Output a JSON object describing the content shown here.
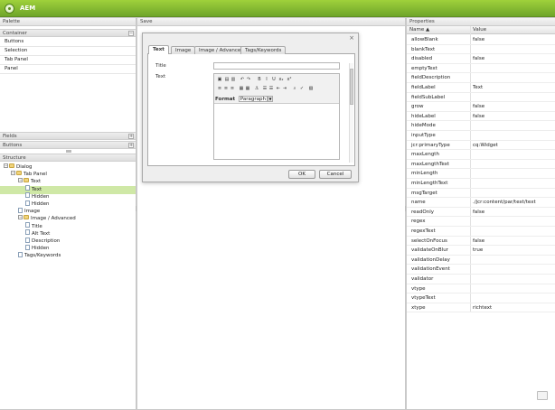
{
  "app": {
    "title": "AEM"
  },
  "palette": {
    "title": "Palette",
    "container_section": "Container",
    "container_items": [
      "Buttons",
      "Selection",
      "Tab Panel",
      "Panel"
    ],
    "fields_section": "Fields",
    "buttons_section": "Buttons",
    "collapse_symbol": "−",
    "expand_symbol": "+"
  },
  "structure": {
    "title": "Structure",
    "nodes": [
      {
        "label": "Dialog",
        "type": "folder",
        "depth": 0,
        "expandable": true,
        "selected": false
      },
      {
        "label": "Tab Panel",
        "type": "folder",
        "depth": 1,
        "expandable": true,
        "selected": false
      },
      {
        "label": "Text",
        "type": "folder",
        "depth": 2,
        "expandable": true,
        "selected": false
      },
      {
        "label": "Text",
        "type": "page",
        "depth": 3,
        "expandable": false,
        "selected": true
      },
      {
        "label": "Hidden",
        "type": "page",
        "depth": 3,
        "expandable": false,
        "selected": false
      },
      {
        "label": "Hidden",
        "type": "page",
        "depth": 3,
        "expandable": false,
        "selected": false
      },
      {
        "label": "Image",
        "type": "page",
        "depth": 2,
        "expandable": false,
        "selected": false
      },
      {
        "label": "Image / Advanced",
        "type": "folder",
        "depth": 2,
        "expandable": true,
        "selected": false
      },
      {
        "label": "Title",
        "type": "page",
        "depth": 3,
        "expandable": false,
        "selected": false
      },
      {
        "label": "Alt Text",
        "type": "page",
        "depth": 3,
        "expandable": false,
        "selected": false
      },
      {
        "label": "Description",
        "type": "page",
        "depth": 3,
        "expandable": false,
        "selected": false
      },
      {
        "label": "Hidden",
        "type": "page",
        "depth": 3,
        "expandable": false,
        "selected": false
      },
      {
        "label": "Tags/Keywords",
        "type": "page",
        "depth": 2,
        "expandable": false,
        "selected": false
      }
    ]
  },
  "save": {
    "title": "Save"
  },
  "dialog": {
    "close_symbol": "×",
    "tabs": [
      "Text",
      "Image",
      "Image / Advanced",
      "Tags/Keywords"
    ],
    "active_tab": 0,
    "title_label": "Title",
    "title_value": "",
    "text_label": "Text",
    "format_label": "Format",
    "format_value": "Paragraph",
    "ok_label": "OK",
    "cancel_label": "Cancel"
  },
  "properties": {
    "title": "Properties",
    "col_name": "Name ▲",
    "col_value": "Value",
    "rows": [
      {
        "name": "allowBlank",
        "value": "false"
      },
      {
        "name": "blankText",
        "value": ""
      },
      {
        "name": "disabled",
        "value": "false"
      },
      {
        "name": "emptyText",
        "value": ""
      },
      {
        "name": "fieldDescription",
        "value": ""
      },
      {
        "name": "fieldLabel",
        "value": "Text"
      },
      {
        "name": "fieldSubLabel",
        "value": ""
      },
      {
        "name": "grow",
        "value": "false"
      },
      {
        "name": "hideLabel",
        "value": "false"
      },
      {
        "name": "hideMode",
        "value": ""
      },
      {
        "name": "inputType",
        "value": ""
      },
      {
        "name": "jcr:primaryType",
        "value": "cq:Widget"
      },
      {
        "name": "maxLength",
        "value": ""
      },
      {
        "name": "maxLengthText",
        "value": ""
      },
      {
        "name": "minLength",
        "value": ""
      },
      {
        "name": "minLengthText",
        "value": ""
      },
      {
        "name": "msgTarget",
        "value": ""
      },
      {
        "name": "name",
        "value": "./jcr:content/par/text/text"
      },
      {
        "name": "readOnly",
        "value": "false"
      },
      {
        "name": "regex",
        "value": ""
      },
      {
        "name": "regexText",
        "value": ""
      },
      {
        "name": "selectOnFocus",
        "value": "false"
      },
      {
        "name": "validateOnBlur",
        "value": "true"
      },
      {
        "name": "validationDelay",
        "value": ""
      },
      {
        "name": "validationEvent",
        "value": ""
      },
      {
        "name": "validator",
        "value": ""
      },
      {
        "name": "vtype",
        "value": ""
      },
      {
        "name": "vtypeText",
        "value": ""
      },
      {
        "name": "xtype",
        "value": "richtext"
      }
    ]
  },
  "rte_toolbar": [
    {
      "icon": "paste-icon",
      "glyph": "▣"
    },
    {
      "icon": "paste-text-icon",
      "glyph": "▤"
    },
    {
      "icon": "paste-word-icon",
      "glyph": "▥"
    },
    {
      "icon": "undo-icon",
      "glyph": "↶"
    },
    {
      "icon": "redo-icon",
      "glyph": "↷"
    },
    {
      "icon": "bold-icon",
      "glyph": "B"
    },
    {
      "icon": "italic-icon",
      "glyph": "I"
    },
    {
      "icon": "underline-icon",
      "glyph": "U"
    },
    {
      "icon": "subscript-icon",
      "glyph": "x₂"
    },
    {
      "icon": "superscript-icon",
      "glyph": "x²"
    },
    {
      "icon": "align-left-icon",
      "glyph": "≡"
    },
    {
      "icon": "align-center-icon",
      "glyph": "≡"
    },
    {
      "icon": "align-right-icon",
      "glyph": "≡"
    },
    {
      "icon": "image-icon",
      "glyph": "▦"
    },
    {
      "icon": "table-icon",
      "glyph": "▦"
    },
    {
      "icon": "anchor-icon",
      "glyph": "⚓"
    },
    {
      "icon": "bulleted-list-icon",
      "glyph": "☰"
    },
    {
      "icon": "numbered-list-icon",
      "glyph": "☰"
    },
    {
      "icon": "outdent-icon",
      "glyph": "⇤"
    },
    {
      "icon": "indent-icon",
      "glyph": "⇥"
    },
    {
      "icon": "find-replace-icon",
      "glyph": "⌕"
    },
    {
      "icon": "spellcheck-icon",
      "glyph": "✓"
    },
    {
      "icon": "source-edit-icon",
      "glyph": "▧"
    },
    {
      "icon": "special-char-icon",
      "glyph": "★"
    },
    {
      "icon": "fullscreen-icon",
      "glyph": "▭"
    }
  ],
  "colors": {
    "brand": "#8cc63f",
    "selected_row": "#cfe8a6"
  }
}
